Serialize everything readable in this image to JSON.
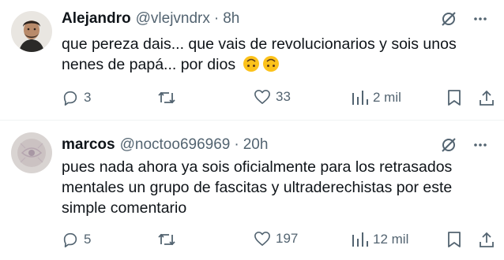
{
  "tweets": [
    {
      "name": "Alejandro",
      "handle": "@vlejvndrx",
      "separator": "·",
      "time": "8h",
      "text_line1": "que pereza dais... que vais de revolucionarios y sois unos",
      "text_line2": "nenes de papá... por dios",
      "replies": "3",
      "retweets": "",
      "likes": "33",
      "views": "2 mil"
    },
    {
      "name": "marcos",
      "handle": "@noctoo696969",
      "separator": "·",
      "time": "20h",
      "text_line1": "pues nada ahora ya sois oficialmente para los retrasados",
      "text_line2": "mentales un grupo de fascitas y ultraderechistas por este",
      "text_line3": "simple comentario",
      "replies": "5",
      "retweets": "",
      "likes": "197",
      "views": "12 mil"
    }
  ],
  "colors": {
    "text": "#0f1419",
    "secondary": "#536471",
    "divider": "#eff3f4"
  },
  "icons": [
    "grok-icon",
    "more-icon",
    "reply-icon",
    "retweet-icon",
    "like-icon",
    "views-icon",
    "bookmark-icon",
    "share-icon",
    "upside-down-face-emoji"
  ]
}
